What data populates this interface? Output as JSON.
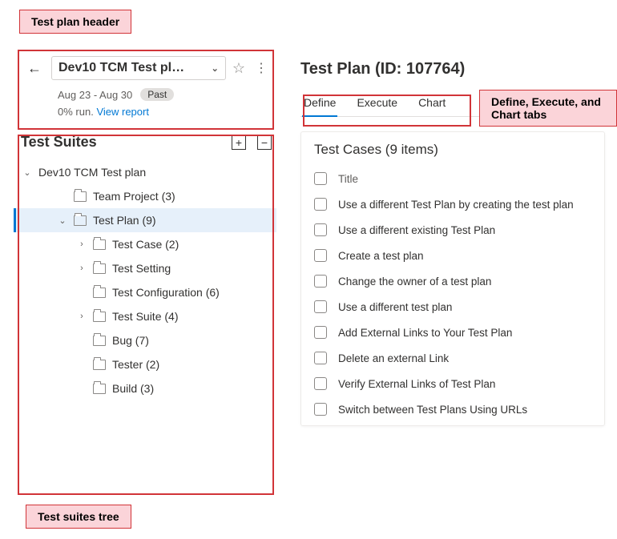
{
  "callouts": {
    "header": "Test plan header",
    "tree": "Test suites tree",
    "tabs": "Define, Execute, and Chart tabs"
  },
  "plan_header": {
    "title": "Dev10 TCM Test pl…",
    "date_range": "Aug 23 - Aug 30",
    "badge": "Past",
    "run_pct": "0% run.",
    "report_link": "View report"
  },
  "suites": {
    "title": "Test Suites",
    "root": "Dev10 TCM Test plan",
    "items": [
      {
        "label": "Team Project (3)",
        "indent": 2,
        "twisty": ""
      },
      {
        "label": "Test Plan (9)",
        "indent": 2,
        "twisty": "v",
        "selected": true
      },
      {
        "label": "Test Case (2)",
        "indent": 3,
        "twisty": ">"
      },
      {
        "label": "Test Setting",
        "indent": 3,
        "twisty": ">"
      },
      {
        "label": "Test Configuration (6)",
        "indent": 3,
        "twisty": ""
      },
      {
        "label": "Test Suite (4)",
        "indent": 3,
        "twisty": ">"
      },
      {
        "label": "Bug (7)",
        "indent": 3,
        "twisty": ""
      },
      {
        "label": "Tester (2)",
        "indent": 3,
        "twisty": ""
      },
      {
        "label": "Build (3)",
        "indent": 3,
        "twisty": ""
      }
    ]
  },
  "right": {
    "title": "Test Plan (ID: 107764)",
    "tabs": [
      "Define",
      "Execute",
      "Chart"
    ],
    "cases_title": "Test Cases (9 items)",
    "column_header": "Title",
    "cases": [
      "Use a different Test Plan by creating the test plan",
      "Use a different existing Test Plan",
      "Create a test plan",
      "Change the owner of a test plan",
      "Use a different test plan",
      "Add External Links to Your Test Plan",
      "Delete an external Link",
      "Verify External Links of Test Plan",
      "Switch between Test Plans Using URLs"
    ]
  }
}
